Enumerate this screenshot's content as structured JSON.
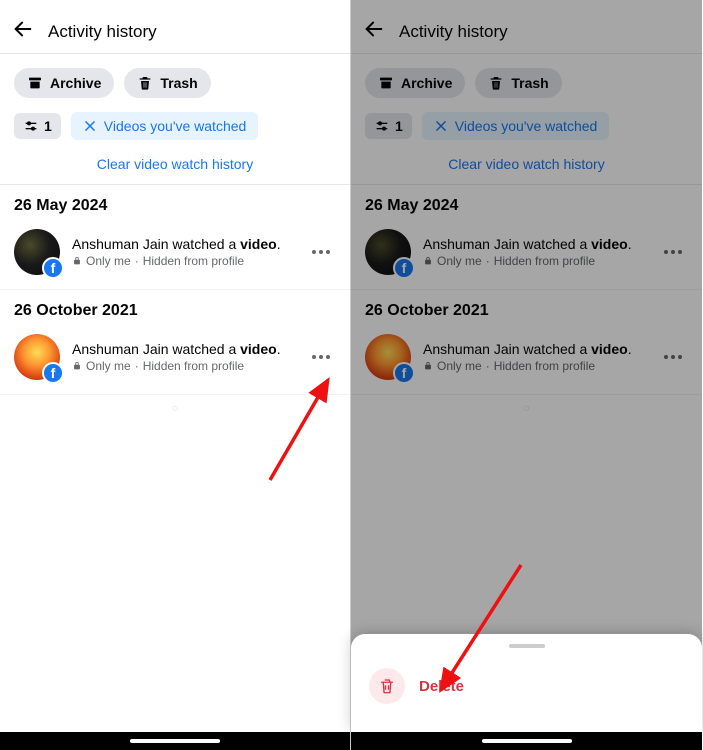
{
  "header": {
    "title": "Activity history"
  },
  "actions": {
    "archive": "Archive",
    "trash": "Trash"
  },
  "filters": {
    "count": "1",
    "videos_watched": "Videos you've watched",
    "clear_link": "Clear video watch history"
  },
  "groups": [
    {
      "date": "26 May 2024",
      "entries": [
        {
          "actor": "Anshuman Jain",
          "verb": " watched a ",
          "object": "video",
          "suffix": ".",
          "privacy": "Only me",
          "hidden": "Hidden from profile",
          "thumb_class": "t1"
        }
      ]
    },
    {
      "date": "26 October 2021",
      "entries": [
        {
          "actor": "Anshuman Jain",
          "verb": " watched a ",
          "object": "video",
          "suffix": ".",
          "privacy": "Only me",
          "hidden": "Hidden from profile",
          "thumb_class": "t2"
        }
      ]
    }
  ],
  "sheet": {
    "delete": "Delete"
  }
}
